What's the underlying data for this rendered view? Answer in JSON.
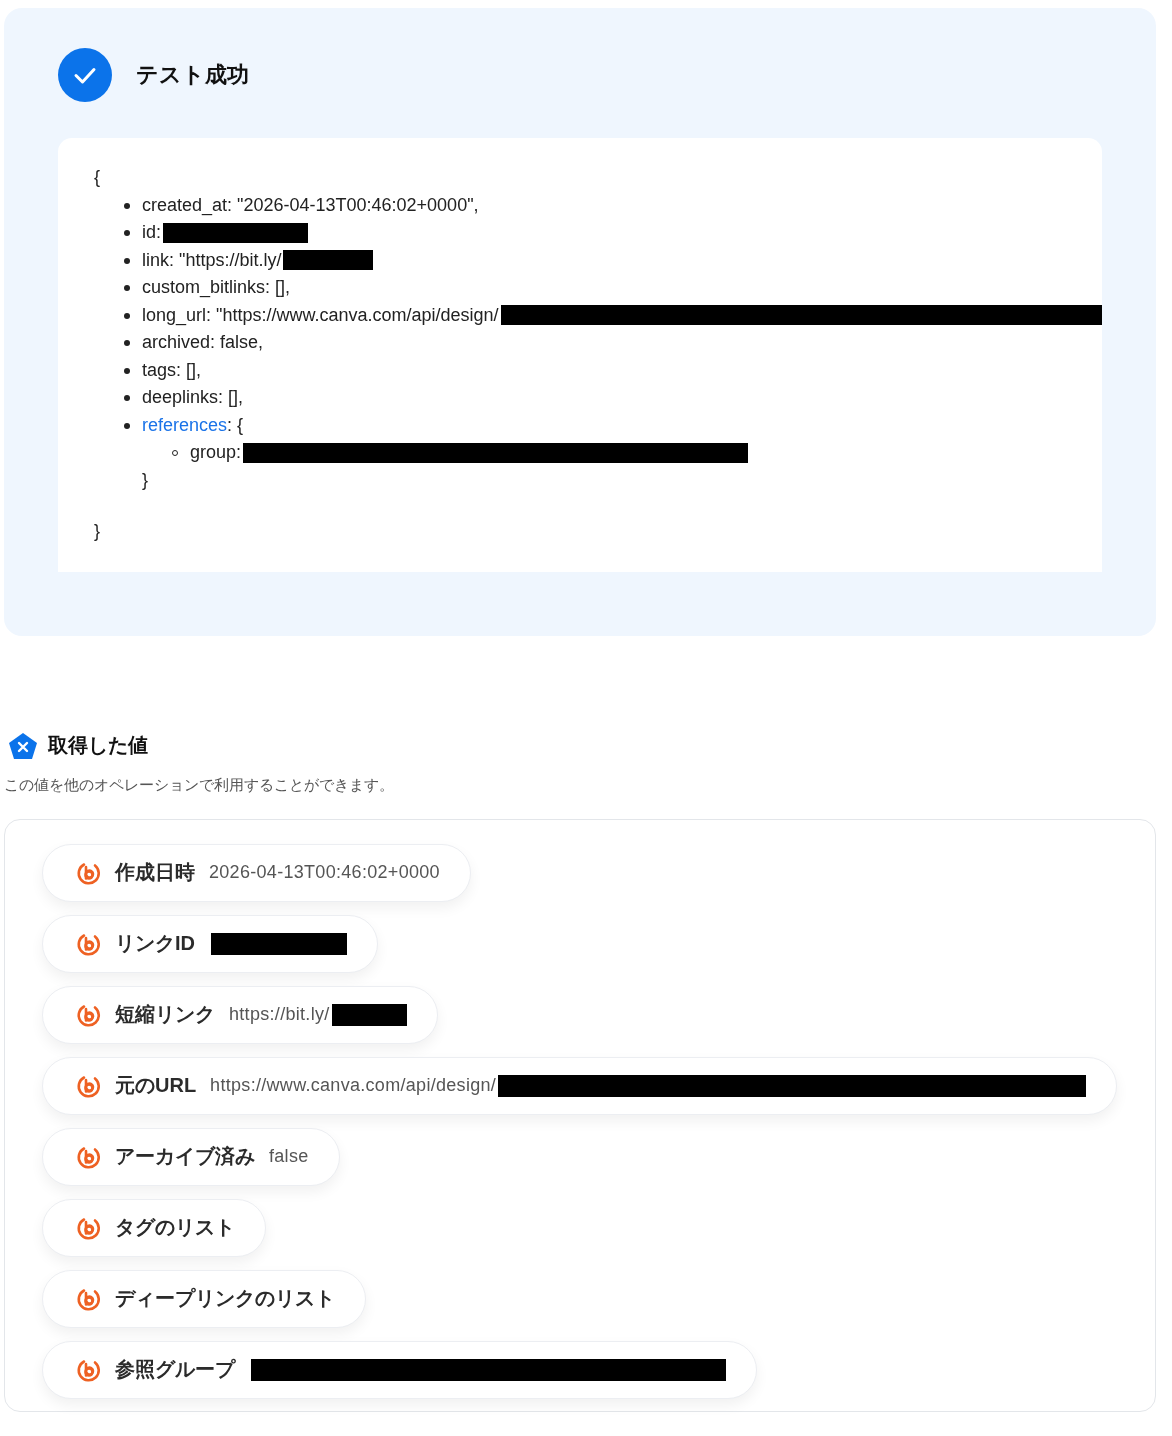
{
  "test_result": {
    "title": "テスト成功",
    "succeeded": true,
    "open_brace": "{",
    "close_brace": "}",
    "lines": [
      {
        "key": "created_at:",
        "value": "\"2026-04-13T00:46:02+0000\","
      },
      {
        "key": "id:",
        "redacted": true
      },
      {
        "key": "link:",
        "value": "\"https://bit.ly/",
        "redacted": true
      },
      {
        "key": "custom_bitlinks:",
        "value": "[],"
      },
      {
        "key": "long_url:",
        "value": "\"https://www.canva.com/api/design/",
        "redacted": true
      },
      {
        "key": "archived:",
        "value": "false,"
      },
      {
        "key": "tags:",
        "value": "[],"
      },
      {
        "key": "deeplinks:",
        "value": "[],"
      },
      {
        "key": "references",
        "value": ": {",
        "link": true,
        "children": [
          {
            "key": "group:",
            "redacted": true
          }
        ],
        "close": "}"
      }
    ]
  },
  "retrieved_values": {
    "title": "取得した値",
    "description": "この値を他のオペレーションで利用することができます。",
    "items": [
      {
        "label": "作成日時",
        "value": "2026-04-13T00:46:02+0000"
      },
      {
        "label": "リンクID",
        "redacted": true
      },
      {
        "label": "短縮リンク",
        "value": "https://bit.ly/",
        "redacted": true
      },
      {
        "label": "元のURL",
        "value": "https://www.canva.com/api/design/",
        "redacted": true
      },
      {
        "label": "アーカイブ済み",
        "value": "false"
      },
      {
        "label": "タグのリスト"
      },
      {
        "label": "ディープリンクのリスト"
      },
      {
        "label": "参照グループ",
        "redacted": true
      }
    ]
  }
}
